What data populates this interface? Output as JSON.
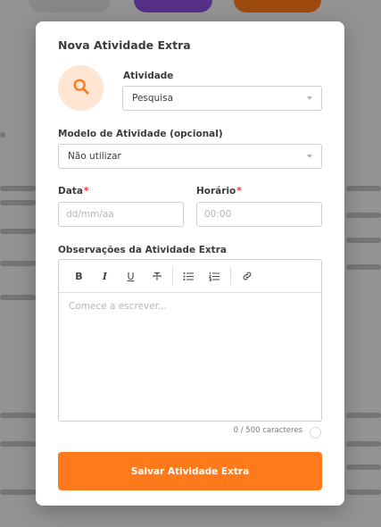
{
  "modal": {
    "title": "Nova Atividade Extra",
    "accent_color": "#ff7a1a",
    "activity_icon": "search-icon"
  },
  "form": {
    "activity": {
      "label": "Atividade",
      "value": "Pesquisa"
    },
    "model": {
      "label": "Modelo de Atividade (opcional)",
      "value": "Não utilizar"
    },
    "date": {
      "label": "Data",
      "required_mark": "*",
      "placeholder": "dd/mm/aa"
    },
    "time": {
      "label": "Horário",
      "required_mark": "*",
      "placeholder": "00:00"
    },
    "notes": {
      "label": "Observações da Atividade Extra",
      "placeholder": "Comece a escrever...",
      "char_count": "0 / 500 caracteres",
      "toolbar": [
        "bold-icon",
        "italic-icon",
        "underline-icon",
        "strikethrough-icon",
        "bullet-list-icon",
        "numbered-list-icon",
        "link-icon"
      ],
      "bold_glyph": "B",
      "italic_glyph": "I",
      "underline_glyph": "U"
    },
    "submit_label": "Salvar Atividade Extra"
  }
}
